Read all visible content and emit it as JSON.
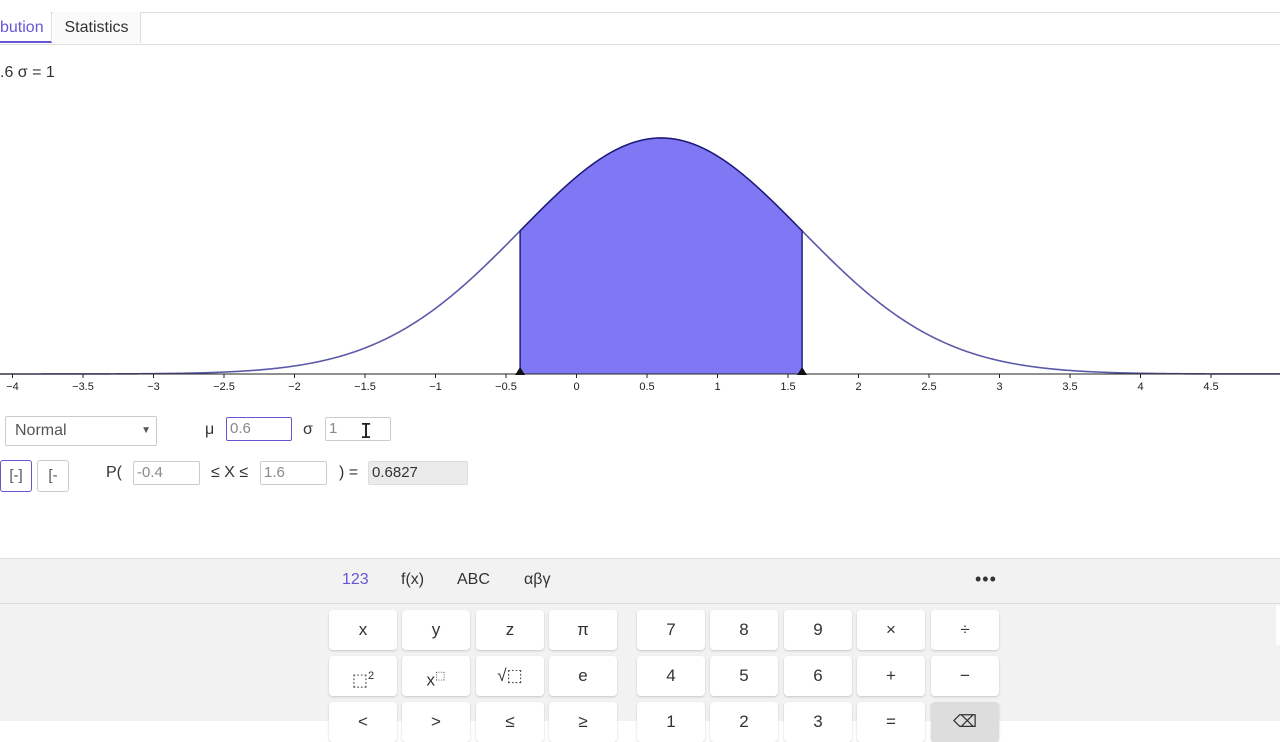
{
  "tabs": {
    "distribution": "bution",
    "statistics": "Statistics"
  },
  "params_label": ".6 σ = 1",
  "chart_data": {
    "type": "area",
    "distribution": "normal",
    "mu": 0.6,
    "sigma": 1,
    "shade_from": -0.4,
    "shade_to": 1.6,
    "xlim": [
      -4.1,
      5.0
    ],
    "tick_labels": [
      "−4",
      "−3.5",
      "−3",
      "−2.5",
      "−2",
      "−1.5",
      "−1",
      "−0.5",
      "0",
      "0.5",
      "1",
      "1.5",
      "2",
      "2.5",
      "3",
      "3.5",
      "4",
      "4.5"
    ],
    "tick_values": [
      -4,
      -3.5,
      -3,
      -2.5,
      -2,
      -1.5,
      -1,
      -0.5,
      0,
      0.5,
      1,
      1.5,
      2,
      2.5,
      3,
      3.5,
      4,
      4.5
    ],
    "curve_color": "#5a5aa8",
    "fill_color": "#8077f5",
    "edge_color": "#1c1a7a"
  },
  "controls": {
    "distribution_select": "Normal",
    "mu_label": "μ",
    "mu_value": "0.6",
    "sigma_label": "σ",
    "sigma_value": "1",
    "prob_open": "P(",
    "lower_value": "-0.4",
    "between_label": "≤ X ≤",
    "upper_value": "1.6",
    "equals_label": ") =",
    "result_value": "0.6827",
    "interval_icon": "[-]",
    "left_icon": "[-"
  },
  "keyboard": {
    "tabs": [
      "123",
      "f(x)",
      "ABC",
      "αβγ"
    ],
    "more": "•••",
    "row1": [
      "x",
      "y",
      "z",
      "π",
      "7",
      "8",
      "9",
      "×",
      "÷"
    ],
    "row2_e": "e",
    "row2_nums": [
      "4",
      "5",
      "6",
      "+",
      "−"
    ],
    "row2_square": "⬚",
    "row2_square_sup": "2",
    "row2_power_base": "x",
    "row2_power_sup": "⬚",
    "row2_sqrt": "√⬚",
    "row3": [
      "<",
      ">",
      "≤",
      "≥",
      "1",
      "2",
      "3",
      "=",
      "⌫"
    ]
  }
}
